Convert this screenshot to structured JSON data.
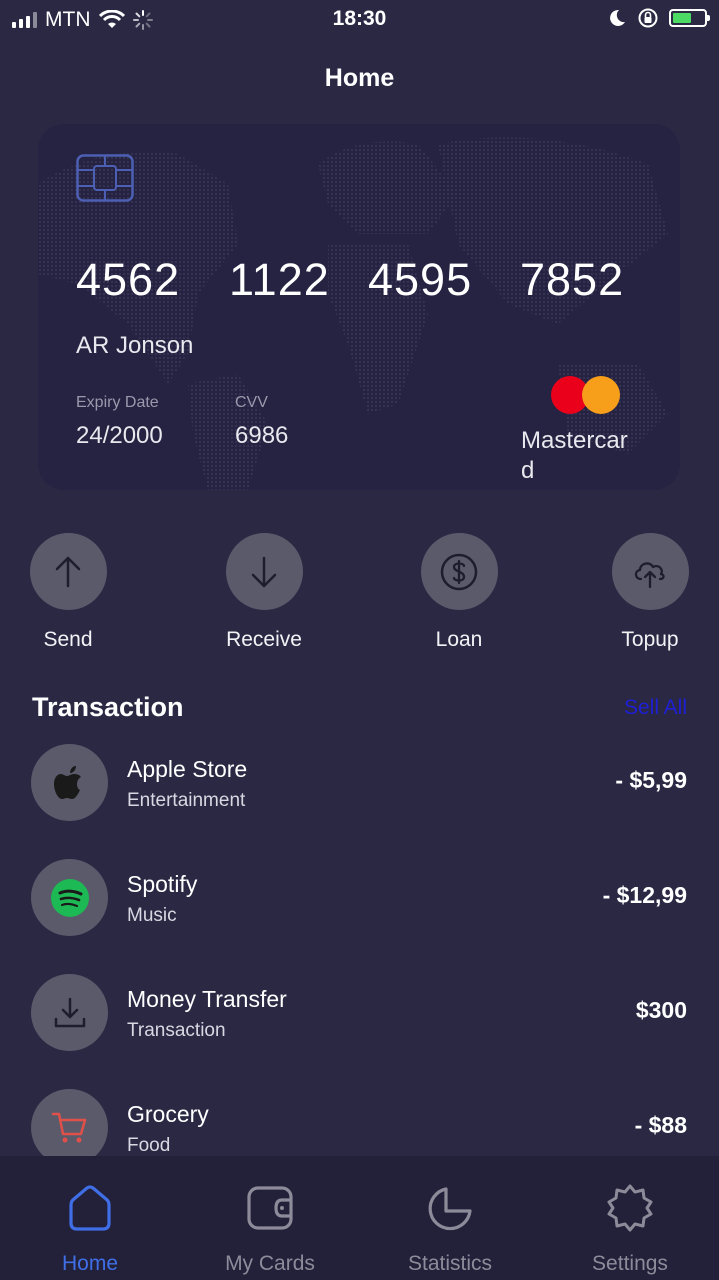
{
  "status_bar": {
    "carrier": "MTN",
    "time": "18:30",
    "battery_color": "#4cd964"
  },
  "header": {
    "title": "Home"
  },
  "card": {
    "number_groups": [
      "4562",
      "1122",
      "4595",
      "7852"
    ],
    "holder": "AR Jonson",
    "expiry_label": "Expiry Date",
    "expiry_value": "24/2000",
    "cvv_label": "CVV",
    "cvv_value": "6986",
    "brand_text": "Mastercard",
    "brand_colors": [
      "#eb001b",
      "#f79e1b"
    ]
  },
  "actions": [
    {
      "label": "Send",
      "icon": "arrow-up-icon"
    },
    {
      "label": "Receive",
      "icon": "arrow-down-icon"
    },
    {
      "label": "Loan",
      "icon": "dollar-icon"
    },
    {
      "label": "Topup",
      "icon": "cloud-upload-icon"
    }
  ],
  "transactions_section": {
    "title": "Transaction",
    "see_all": "Sell All",
    "see_all_color": "#1f1fd6"
  },
  "transactions": [
    {
      "name": "Apple Store",
      "category": "Entertainment",
      "amount": "- $5,99",
      "icon": "apple-icon"
    },
    {
      "name": "Spotify",
      "category": "Music",
      "amount": "- $12,99",
      "icon": "spotify-icon"
    },
    {
      "name": "Money Transfer",
      "category": "Transaction",
      "amount": "$300",
      "icon": "download-icon"
    },
    {
      "name": "Grocery",
      "category": "Food",
      "amount": "- $88",
      "icon": "cart-icon"
    }
  ],
  "bottom_nav": {
    "active": "Home",
    "active_color": "#3f6ee6",
    "items": [
      {
        "label": "Home",
        "icon": "home-icon"
      },
      {
        "label": "My Cards",
        "icon": "wallet-icon"
      },
      {
        "label": "Statistics",
        "icon": "pie-chart-icon"
      },
      {
        "label": "Settings",
        "icon": "gear-icon"
      }
    ]
  }
}
